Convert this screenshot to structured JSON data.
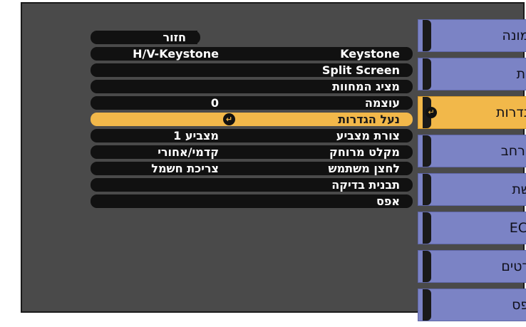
{
  "tabs": [
    {
      "label": "תמונה",
      "active": false
    },
    {
      "label": "אות",
      "active": false
    },
    {
      "label": "הגדרות",
      "active": true
    },
    {
      "label": "מורחב",
      "active": false
    },
    {
      "label": "רשת",
      "active": false
    },
    {
      "label": "ECO",
      "active": false
    },
    {
      "label": "פרטים",
      "active": false
    },
    {
      "label": "אפס",
      "active": false
    }
  ],
  "menu": {
    "back_label": "חזור",
    "items": [
      {
        "label": "Keystone",
        "value": "H/V-Keystone"
      },
      {
        "label": "Split Screen",
        "value": ""
      },
      {
        "label": "מציג המחוות",
        "value": ""
      },
      {
        "label": "עוצמה",
        "value": "0"
      },
      {
        "label": "נעל הגדרות",
        "value": "",
        "selected": true
      },
      {
        "label": "צורת מצביע",
        "value": "מצביע 1"
      },
      {
        "label": "מקלט מרוחק",
        "value": "קדמי/אחורי"
      },
      {
        "label": "לחצן משתמש",
        "value": "צריכת חשמל"
      },
      {
        "label": "תבנית בדיקה",
        "value": ""
      },
      {
        "label": "אפס",
        "value": ""
      }
    ]
  },
  "colors": {
    "tab": "#7b83c5",
    "highlight": "#f2b84a",
    "panel": "#4a4a4a"
  },
  "icons": {
    "enter": "enter-icon"
  }
}
